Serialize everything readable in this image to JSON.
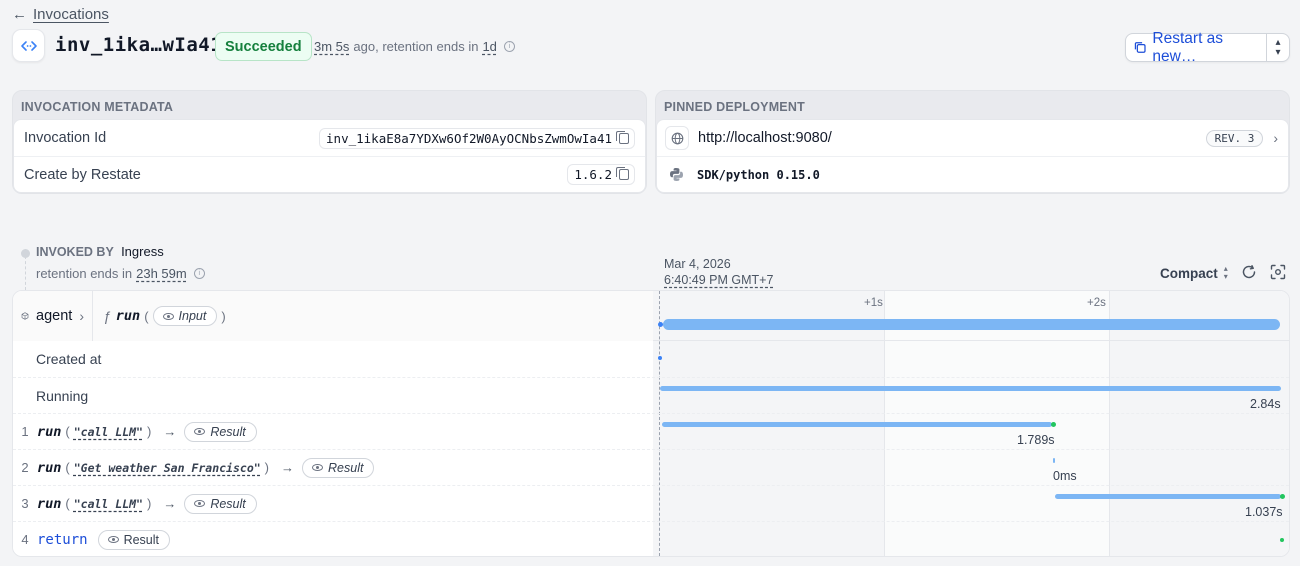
{
  "breadcrumb": {
    "back_label": "Invocations"
  },
  "header": {
    "invocation_short_id": "inv_1ika…wIa41",
    "status": "Succeeded",
    "age": "3m 5s",
    "age_suffix": "ago, retention ends in",
    "retention": "1d",
    "restart_label": "Restart as new…"
  },
  "metadata": {
    "title": "INVOCATION METADATA",
    "rows": [
      {
        "key": "Invocation Id",
        "value": "inv_1ikaE8a7YDXw6Of2W0AyOCNbsZwmOwIa41"
      },
      {
        "key": "Create by Restate",
        "value": "1.6.2"
      }
    ]
  },
  "deployment": {
    "title": "PINNED DEPLOYMENT",
    "url": "http://localhost:9080/",
    "revision": "REV. 3",
    "sdk": "SDK/python 0.15.0"
  },
  "invoked_by": {
    "label": "INVOKED BY",
    "source": "Ingress",
    "retention_prefix": "retention ends in",
    "retention": "23h 59m"
  },
  "timeline": {
    "date": "Mar 4, 2026",
    "time": "6:40:49 PM GMT+7",
    "view_mode": "Compact",
    "ticks": [
      "+1s",
      "+2s"
    ],
    "service": "agent",
    "handler": "run",
    "input_label": "Input",
    "rows": [
      {
        "label": "Created at"
      },
      {
        "label": "Running",
        "duration": "2.84s"
      }
    ],
    "steps": [
      {
        "index": "1",
        "fn": "run",
        "arg": "\"call LLM\"",
        "result_label": "Result",
        "duration": "1.789s"
      },
      {
        "index": "2",
        "fn": "run",
        "arg": "\"Get weather San Francisco\"",
        "result_label": "Result",
        "duration": "0ms"
      },
      {
        "index": "3",
        "fn": "run",
        "arg": "\"call LLM\"",
        "result_label": "Result",
        "duration": "1.037s"
      },
      {
        "index": "4",
        "fn": "return",
        "result_label": "Result"
      }
    ]
  },
  "colors": {
    "accent_blue": "#1d4ed8",
    "bar_blue": "#7cb6f4",
    "success_green": "#22c55e"
  }
}
